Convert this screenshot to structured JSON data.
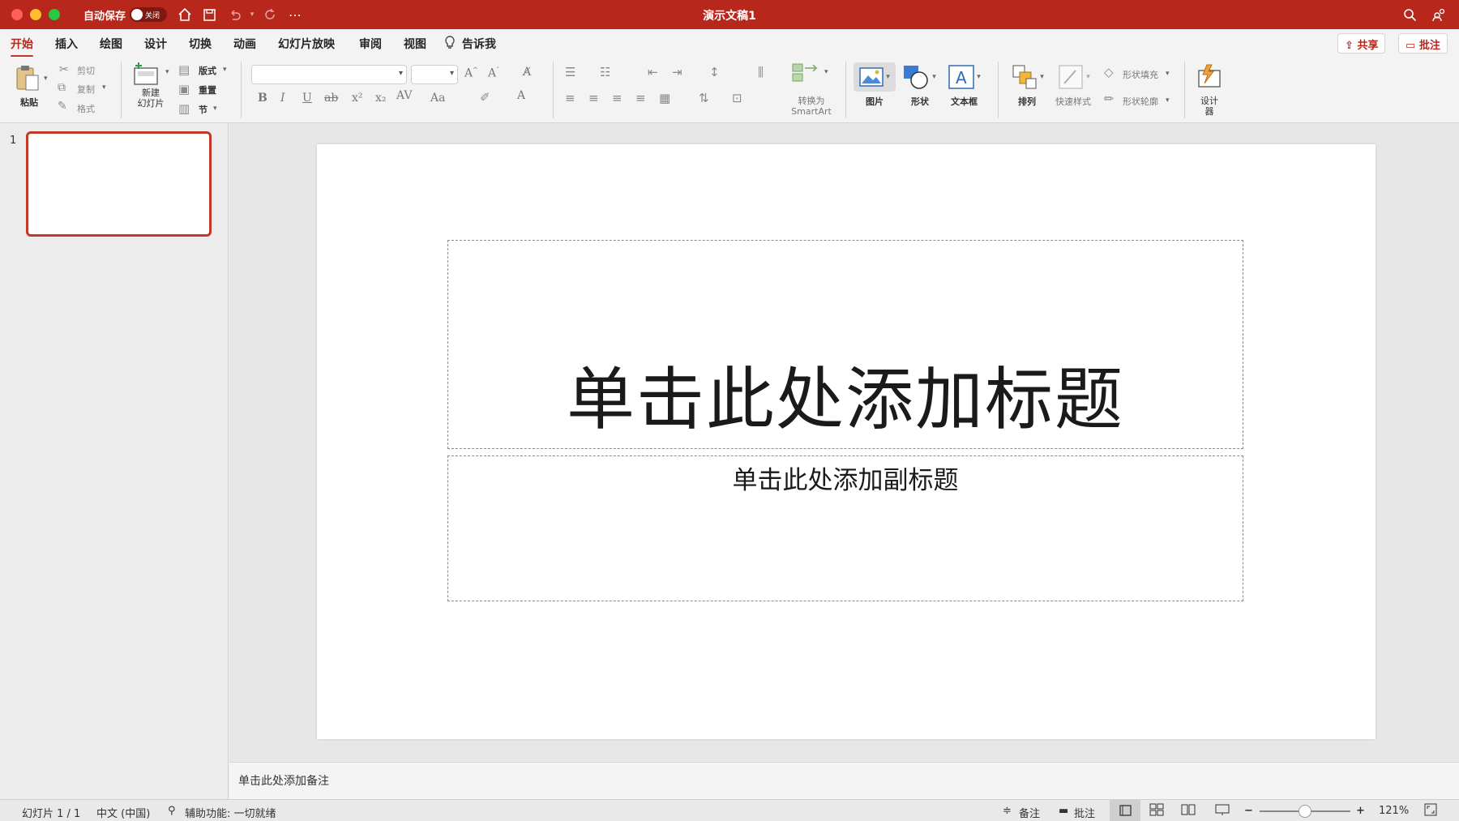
{
  "window": {
    "title": "演示文稿1",
    "autosave_label": "自动保存",
    "autosave_state": "关闭"
  },
  "tabs": [
    {
      "label": "开始",
      "active": true
    },
    {
      "label": "插入"
    },
    {
      "label": "绘图"
    },
    {
      "label": "设计"
    },
    {
      "label": "切换"
    },
    {
      "label": "动画"
    },
    {
      "label": "幻灯片放映"
    },
    {
      "label": "审阅"
    },
    {
      "label": "视图"
    },
    {
      "label": "告诉我"
    }
  ],
  "actions": {
    "share": "共享",
    "comment": "批注"
  },
  "ribbon": {
    "paste": "粘贴",
    "cut": "剪切",
    "copy": "复制",
    "format": "格式",
    "new_slide": "新建",
    "new_slide_2": "幻灯片",
    "layout": "版式",
    "reset": "重置",
    "section": "节",
    "convert_smartart_1": "转换为",
    "convert_smartart_2": "SmartArt",
    "picture": "图片",
    "shape": "形状",
    "textbox": "文本框",
    "arrange": "排列",
    "quick_styles": "快速样式",
    "shape_fill": "形状填充",
    "shape_outline": "形状轮廓",
    "designer_1": "设计",
    "designer_2": "器",
    "font_name": "",
    "font_size": ""
  },
  "slides": {
    "number": "1"
  },
  "slide": {
    "title_placeholder": "单击此处添加标题",
    "subtitle_placeholder": "单击此处添加副标题"
  },
  "notes": {
    "placeholder": "单击此处添加备注"
  },
  "status": {
    "slide_count": "幻灯片 1 / 1",
    "language": "中文 (中国)",
    "accessibility": "辅助功能: 一切就绪",
    "notes_btn": "备注",
    "comments_btn": "批注",
    "zoom": "121%"
  },
  "colors": {
    "accent": "#b8271c"
  }
}
